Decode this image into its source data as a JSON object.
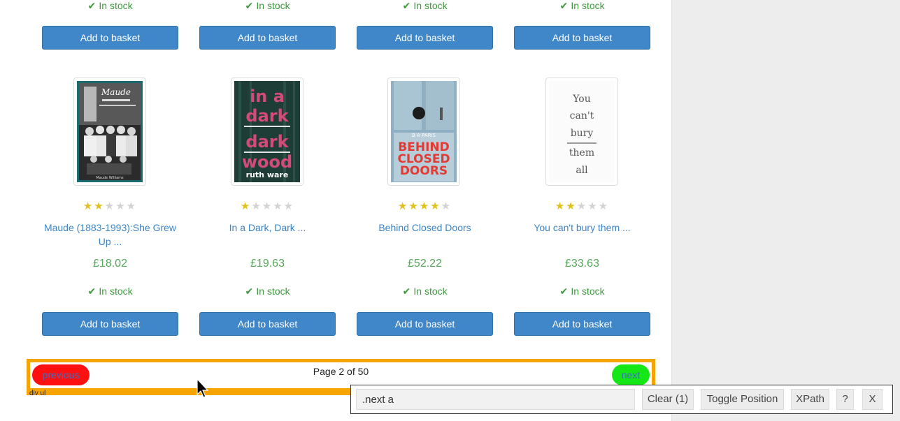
{
  "catalogue": {
    "top_row": [
      {
        "stock": "In stock",
        "button": "Add to basket"
      },
      {
        "stock": "In stock",
        "button": "Add to basket"
      },
      {
        "stock": "In stock",
        "button": "Add to basket"
      },
      {
        "stock": "In stock",
        "button": "Add to basket"
      }
    ],
    "products": [
      {
        "title": "Maude (1883-1993):She Grew Up ...",
        "price": "£18.02",
        "stock": "In stock",
        "button": "Add to basket",
        "rating": 2,
        "cover_text": [
          "Maude",
          "Maude Williams"
        ]
      },
      {
        "title": "In a Dark, Dark ...",
        "price": "£19.63",
        "stock": "In stock",
        "button": "Add to basket",
        "rating": 1,
        "cover_text": [
          "in a",
          "dark",
          "dark",
          "wood",
          "ruth ware"
        ]
      },
      {
        "title": "Behind Closed Doors",
        "price": "£52.22",
        "stock": "In stock",
        "button": "Add to basket",
        "rating": 4,
        "cover_text": [
          "B A PARIS",
          "BEHIND",
          "CLOSED",
          "DOORS"
        ]
      },
      {
        "title": "You can't bury them ...",
        "price": "£33.63",
        "stock": "In stock",
        "button": "Add to basket",
        "rating": 2,
        "cover_text": [
          "You",
          "can't",
          "bury",
          "them",
          "all"
        ]
      }
    ]
  },
  "pager": {
    "previous_label": "previous",
    "current_label": "Page 2 of 50",
    "next_label": "next",
    "selector_tag": "div ul"
  },
  "selector_toolbar": {
    "query_value": ".next a",
    "clear_label": "Clear (1)",
    "toggle_label": "Toggle Position",
    "xpath_label": "XPath",
    "help_label": "?",
    "close_label": "X"
  },
  "icons": {
    "stock": "check-icon",
    "rating": "star-icon",
    "cursor": "mouse-pointer-icon"
  },
  "colors": {
    "basket_button": "#3f87c9",
    "stock_green": "#3c9a3c",
    "price_green": "#54a857",
    "link_blue": "#3d85c6",
    "star_gold": "#e3c019",
    "highlight_orange": "#f7a400",
    "previous_red": "#ff1010",
    "next_green": "#15e615"
  }
}
